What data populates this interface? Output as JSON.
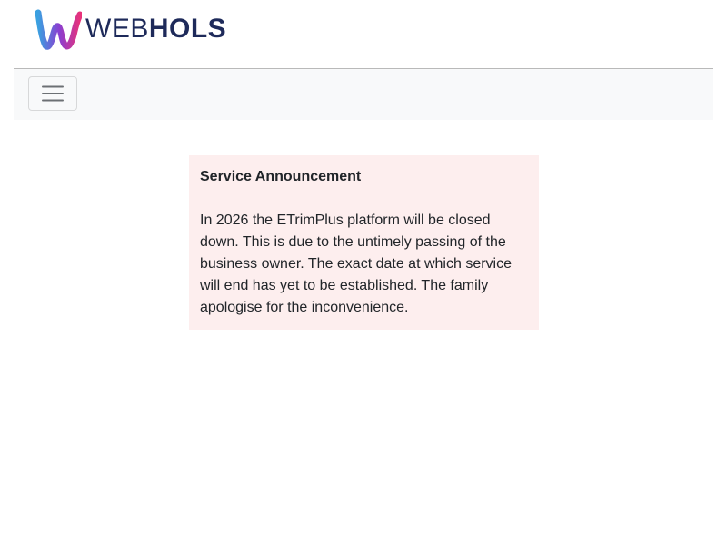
{
  "brand": {
    "logo_icon": "webhols-w-logo-icon",
    "name_light": "WEB",
    "name_bold": "HOLS",
    "colors": {
      "text": "#1e2a5a",
      "gradient_start": "#3aa0e0",
      "gradient_mid": "#8a3fd1",
      "gradient_end": "#e8327a"
    }
  },
  "navbar": {
    "toggler_icon": "hamburger-menu-icon",
    "background": "#f8f9fa"
  },
  "announcement": {
    "title": "Service Announcement",
    "body": "In 2026 the ETrimPlus platform will be closed down. This is due to the untimely passing of the business owner. The exact date at which service will end has yet to be established. The family apologise for the inconvenience.",
    "background": "#fdeeee"
  }
}
